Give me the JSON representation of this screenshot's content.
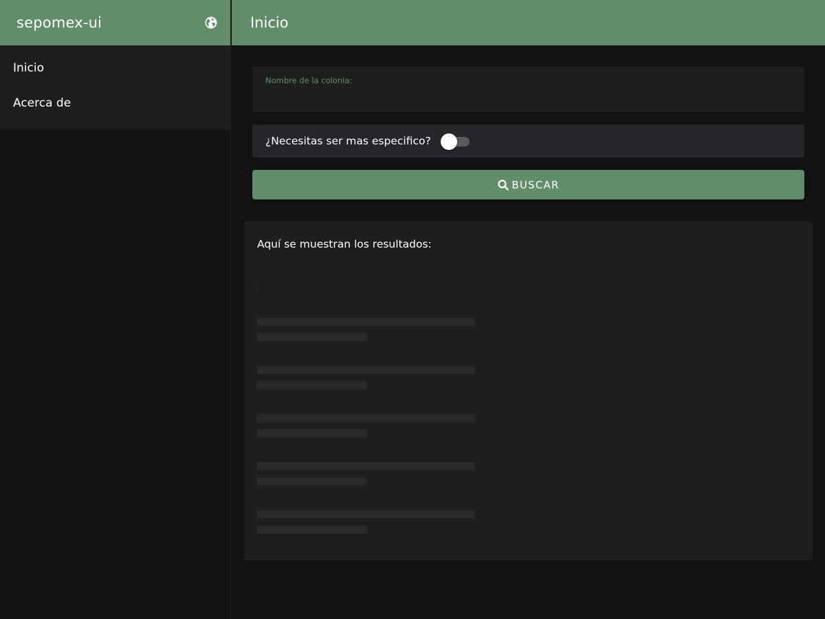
{
  "app": {
    "title": "sepomex-ui",
    "language_icon": "globe-icon"
  },
  "sidebar": {
    "items": [
      {
        "label": "Inicio"
      },
      {
        "label": "Acerca de"
      }
    ]
  },
  "header": {
    "title": "Inicio"
  },
  "form": {
    "colonia_label": "Nombre de la colonia:",
    "colonia_value": "",
    "switch_label": "¿Necesitas ser mas especifico?",
    "switch_on": false,
    "search_icon": "search-icon",
    "search_label": "BUSCAR"
  },
  "results": {
    "title": "Aquí se muestran los resultados:",
    "loading_placeholders": 5
  },
  "colors": {
    "primary": "#628d6a",
    "background": "#121212",
    "surface": "#1e1e1e",
    "switch_surface": "#24262a"
  }
}
